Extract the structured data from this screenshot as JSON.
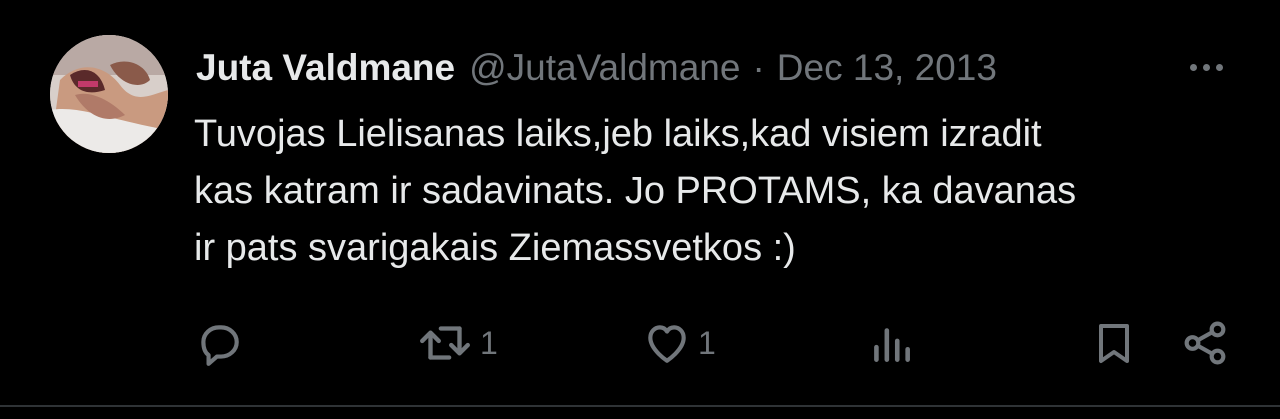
{
  "tweet": {
    "author": {
      "display_name": "Juta Valdmane",
      "handle": "@JutaValdmane"
    },
    "separator": "·",
    "date": "Dec 13, 2013",
    "body_lines": [
      "Tuvojas Lielisanas laiks,jeb laiks,kad visiem izradit",
      "kas katram ir sadavinats. Jo PROTAMS, ka davanas",
      "ir pats svarigakais Ziemassvetkos :)"
    ],
    "actions": {
      "reply": {
        "icon": "reply-icon"
      },
      "retweet": {
        "icon": "retweet-icon",
        "count": "1"
      },
      "like": {
        "icon": "heart-icon",
        "count": "1"
      },
      "views": {
        "icon": "views-icon"
      },
      "bookmark": {
        "icon": "bookmark-icon"
      },
      "share": {
        "icon": "share-icon"
      }
    },
    "more_icon": "more-options-icon",
    "colors": {
      "background": "#000000",
      "primary_text": "#e7e9ea",
      "secondary_text": "#71767b",
      "divider": "#2f3336"
    }
  }
}
